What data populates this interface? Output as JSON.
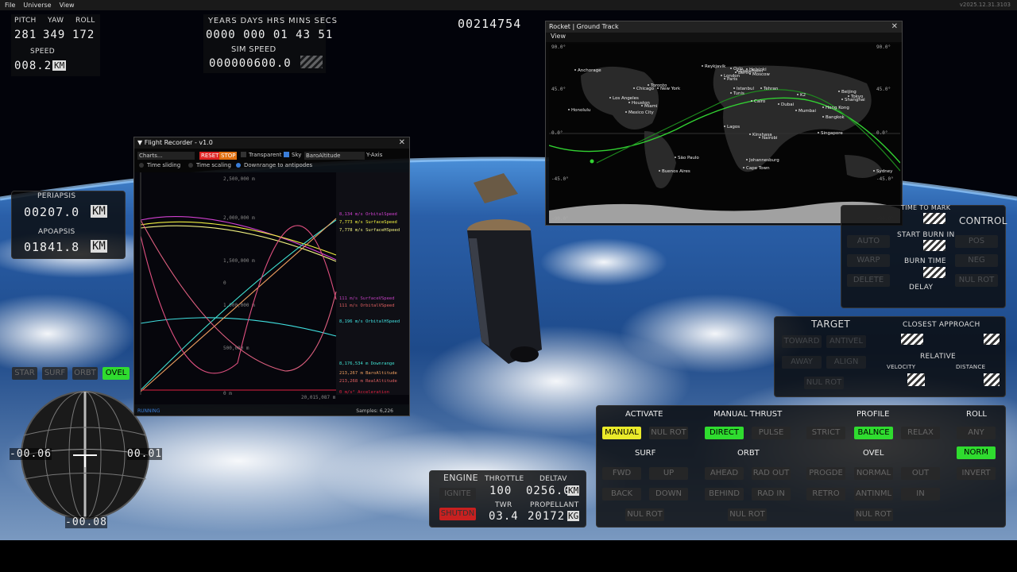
{
  "menu": {
    "file": "File",
    "universe": "Universe",
    "view": "View",
    "version": "v2025.12.31.3103"
  },
  "attitude": {
    "pitch_label": "PITCH",
    "yaw_label": "YAW",
    "roll_label": "ROLL",
    "pitch": "281",
    "yaw": "349",
    "roll": "172",
    "speed_label": "SPEED",
    "speed": "008.2",
    "speed_unit": "KM"
  },
  "time": {
    "header": "YEARS DAYS HRS MINS SECS",
    "value": "0000 000 01 43 51",
    "sim_label": "SIM SPEED",
    "sim_value": "000000600.0",
    "counter": "00214754"
  },
  "orbit": {
    "peri_label": "PERIAPSIS",
    "peri": "00207.0",
    "apo_label": "APOAPSIS",
    "apo": "01841.8",
    "unit": "KM"
  },
  "ref_buttons": [
    "STAR",
    "SURF",
    "ORBT",
    "OVEL"
  ],
  "navball": {
    "left": "-00.06",
    "right": "00.01",
    "bottom": "-00.08"
  },
  "ground_track": {
    "title": "Rocket | Ground Track",
    "menu": "View",
    "lat_labels": [
      "90.0°",
      "45.0°",
      "0.0°",
      "-45.0°",
      "-90.0°"
    ],
    "lat_labels_right": [
      "90.0°",
      "45.0°",
      "0.0°",
      "-45.0°",
      "-90.0°"
    ],
    "cities": [
      {
        "name": "Reykjavik"
      },
      {
        "name": "Anchorage"
      },
      {
        "name": "Oslo"
      },
      {
        "name": "Stockholm"
      },
      {
        "name": "Helsinki"
      },
      {
        "name": "London"
      },
      {
        "name": "Moscow"
      },
      {
        "name": "Berlin"
      },
      {
        "name": "Paris"
      },
      {
        "name": "Toronto"
      },
      {
        "name": "Chicago"
      },
      {
        "name": "New York"
      },
      {
        "name": "Istanbul"
      },
      {
        "name": "Tunis"
      },
      {
        "name": "Tehran"
      },
      {
        "name": "Beijing"
      },
      {
        "name": "Tokyo"
      },
      {
        "name": "Shanghai"
      },
      {
        "name": "Los Angeles"
      },
      {
        "name": "Houston"
      },
      {
        "name": "Miami"
      },
      {
        "name": "K2"
      },
      {
        "name": "Cairo"
      },
      {
        "name": "Dubai"
      },
      {
        "name": "Bangkok"
      },
      {
        "name": "Hong Kong"
      },
      {
        "name": "Mumbai"
      },
      {
        "name": "Honolulu"
      },
      {
        "name": "Mexico City"
      },
      {
        "name": "Lagos"
      },
      {
        "name": "Nairobi"
      },
      {
        "name": "Singapore"
      },
      {
        "name": "Kinshasa"
      },
      {
        "name": "São Paulo"
      },
      {
        "name": "Johannesburg"
      },
      {
        "name": "Buenos Aires"
      },
      {
        "name": "Cape Town"
      },
      {
        "name": "Sydney"
      }
    ]
  },
  "recorder": {
    "title": "Flight Recorder - v1.0",
    "charts": "Charts...",
    "reset": "RESET",
    "stop": "STOP",
    "transparent": "Transparent",
    "sky": "Sky",
    "baro": "BaroAltitude",
    "yaxis": "Y-Axis",
    "time_sliding": "Time sliding",
    "time_scaling": "Time scaling",
    "downrange": "Downrange to antipodes",
    "y_ticks": [
      "2,500,000 m",
      "2,000,000 m",
      "1,500,000 m",
      "0",
      "1,000,000 m",
      "500,000 m",
      "0 m"
    ],
    "x_end": "20,015,087 m",
    "legend": [
      {
        "text": "8,134 m/s OrbitalSpeed",
        "color": "#d040d0"
      },
      {
        "text": "7,773 m/s SurfaceSpeed",
        "color": "#f0f040"
      },
      {
        "text": "7,778 m/s SurfaceHSpeed",
        "color": "#f0f080"
      },
      {
        "text": "111 m/s SurfaceVSpeed",
        "color": "#c040c0"
      },
      {
        "text": "111 m/s OrbitalVSpeed",
        "color": "#e06060"
      },
      {
        "text": "8,196 m/s OrbitalHSpeed",
        "color": "#40e0e0"
      },
      {
        "text": "8,176,534 m Downrange",
        "color": "#40e0d0"
      },
      {
        "text": "213,267 m BaroAltitude",
        "color": "#f0a060"
      },
      {
        "text": "213,268 m RealAltitude",
        "color": "#e06060"
      },
      {
        "text": "0 m/s² Acceleration",
        "color": "#e02040"
      }
    ],
    "status": "RUNNING",
    "samples": "Samples: 6,226"
  },
  "control": {
    "time_to_mark": "TIME TO MARK",
    "title": "CONTROL",
    "start_burn": "START BURN IN",
    "burn_time": "BURN TIME",
    "delay": "DELAY",
    "auto": "AUTO",
    "warp": "WARP",
    "delete": "DELETE",
    "pos": "POS",
    "neg": "NEG",
    "nulrot": "NUL ROT"
  },
  "target": {
    "title": "TARGET",
    "closest": "CLOSEST APPROACH",
    "toward": "TOWARD",
    "antivel": "ANTIVEL",
    "away": "AWAY",
    "align": "ALIGN",
    "nulrot": "NUL ROT",
    "relative": "RELATIVE",
    "velocity": "VELOCITY",
    "distance": "DISTANCE"
  },
  "engine": {
    "title": "ENGINE",
    "ignite": "IGNITE",
    "shutdn": "SHUTDN",
    "throttle_label": "THROTTLE",
    "throttle": "100",
    "deltav_label": "DELTAV",
    "deltav": "0256.0",
    "deltav_unit": "KM",
    "twr_label": "TWR",
    "twr": "03.4",
    "prop_label": "PROPELLANT",
    "prop": "20172",
    "prop_unit": "KG"
  },
  "autopilot": {
    "activate": "ACTIVATE",
    "manual": "MANUAL",
    "nulrot": "NUL ROT",
    "thrust": "MANUAL THRUST",
    "direct": "DIRECT",
    "pulse": "PULSE",
    "profile": "PROFILE",
    "strict": "STRICT",
    "balnce": "BALNCE",
    "relax": "RELAX",
    "roll": "ROLL",
    "any": "ANY",
    "norm": "NORM",
    "invert": "INVERT",
    "surf": "SURF",
    "fwd": "FWD",
    "up": "UP",
    "back": "BACK",
    "down": "DOWN",
    "surf_nul": "NUL ROT",
    "orbt": "ORBT",
    "ahead": "AHEAD",
    "radout": "RAD OUT",
    "behind": "BEHIND",
    "radin": "RAD IN",
    "orbt_nul": "NUL ROT",
    "ovel": "OVEL",
    "progde": "PROGDE",
    "normal": "NORMAL",
    "out": "OUT",
    "retro": "RETRO",
    "antinml": "ANTINML",
    "in": "IN",
    "ovel_nul": "NUL ROT"
  },
  "colors": {
    "green": "#2fdc2f",
    "yellow": "#eaea2a",
    "red": "#c82020"
  }
}
